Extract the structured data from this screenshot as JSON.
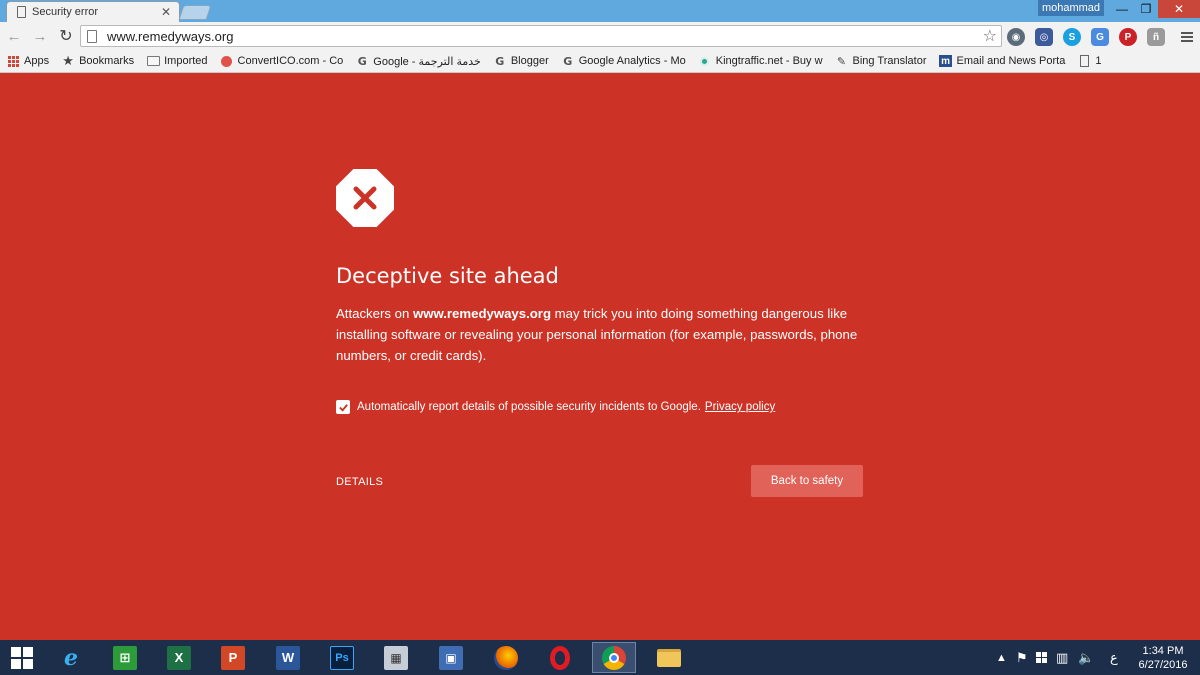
{
  "window": {
    "tab_title": "Security error",
    "tab_close": "✕",
    "user": "mohammad",
    "min": "—",
    "max": "❐",
    "close": "✕"
  },
  "toolbar": {
    "back": "←",
    "forward": "→",
    "reload": "↻",
    "url": "www.remedyways.org",
    "star": "☆"
  },
  "bookmarks": [
    {
      "icon": "apps-icon",
      "label": "Apps"
    },
    {
      "icon": "star-icon",
      "label": "Bookmarks"
    },
    {
      "icon": "folder-icon",
      "label": "Imported"
    },
    {
      "icon": "convertico-icon",
      "label": "ConvertICO.com - Co"
    },
    {
      "icon": "google-icon",
      "label": "Google - خدمة الترجمة"
    },
    {
      "icon": "google-icon",
      "label": "Blogger"
    },
    {
      "icon": "google-icon",
      "label": "Google Analytics - Mo"
    },
    {
      "icon": "kingtraffic-icon",
      "label": "Kingtraffic.net - Buy w"
    },
    {
      "icon": "bing-icon",
      "label": "Bing Translator"
    },
    {
      "icon": "m-icon",
      "label": "Email and News Porta"
    },
    {
      "icon": "page-icon",
      "label": "1"
    }
  ],
  "warning": {
    "heading": "Deceptive site ahead",
    "body_prefix": "Attackers on ",
    "body_domain": "www.remedyways.org",
    "body_suffix": " may trick you into doing something dangerous like installing software or revealing your personal information (for example, passwords, phone numbers, or credit cards).",
    "report_text": "Automatically report details of possible security incidents to Google.",
    "privacy_link": "Privacy policy",
    "report_checked": true,
    "details_label": "DETAILS",
    "safety_button": "Back to safety"
  },
  "taskbar": {
    "clock_time": "1:34 PM",
    "clock_date": "6/27/2016",
    "lang": "ع",
    "tray_arrow": "▲"
  },
  "colors": {
    "danger_bg": "#cc3326",
    "button_bg": "#e06258",
    "titlebar": "#5fa9df",
    "taskbar": "#1d2e4a"
  }
}
